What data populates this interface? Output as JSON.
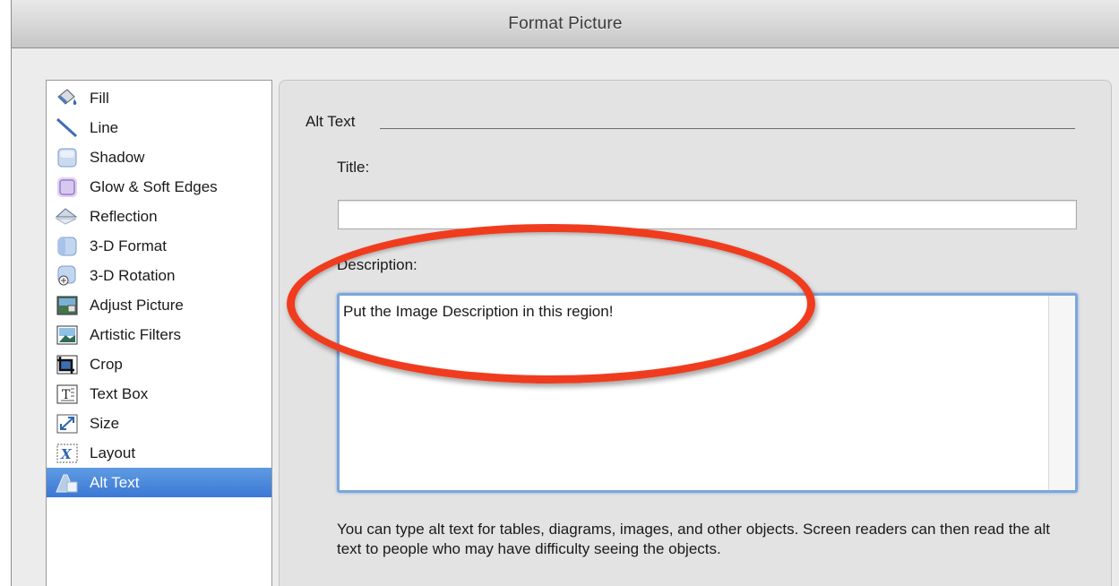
{
  "window": {
    "title": "Format Picture"
  },
  "sidebar": {
    "items": [
      {
        "label": "Fill",
        "icon": "paint-bucket-icon"
      },
      {
        "label": "Line",
        "icon": "line-icon"
      },
      {
        "label": "Shadow",
        "icon": "shadow-icon"
      },
      {
        "label": "Glow & Soft Edges",
        "icon": "glow-icon"
      },
      {
        "label": "Reflection",
        "icon": "reflection-icon"
      },
      {
        "label": "3-D Format",
        "icon": "3d-format-icon"
      },
      {
        "label": "3-D Rotation",
        "icon": "3d-rotation-icon"
      },
      {
        "label": "Adjust Picture",
        "icon": "adjust-picture-icon"
      },
      {
        "label": "Artistic Filters",
        "icon": "artistic-filters-icon"
      },
      {
        "label": "Crop",
        "icon": "crop-icon"
      },
      {
        "label": "Text Box",
        "icon": "text-box-icon"
      },
      {
        "label": "Size",
        "icon": "size-icon"
      },
      {
        "label": "Layout",
        "icon": "layout-icon"
      },
      {
        "label": "Alt Text",
        "icon": "alt-text-icon"
      }
    ],
    "selected": "Alt Text"
  },
  "panel": {
    "section_title": "Alt Text",
    "title_label": "Title:",
    "title_value": "",
    "description_label": "Description:",
    "description_value": "Put the Image Description in this region!",
    "help_text": "You can type alt text for tables, diagrams, images, and other objects. Screen readers can then read the alt text to people who may have difficulty seeing the objects."
  },
  "colors": {
    "selection": "#3b78d4",
    "annotation": "#f03c1e",
    "focus_ring": "#7ba6de"
  }
}
